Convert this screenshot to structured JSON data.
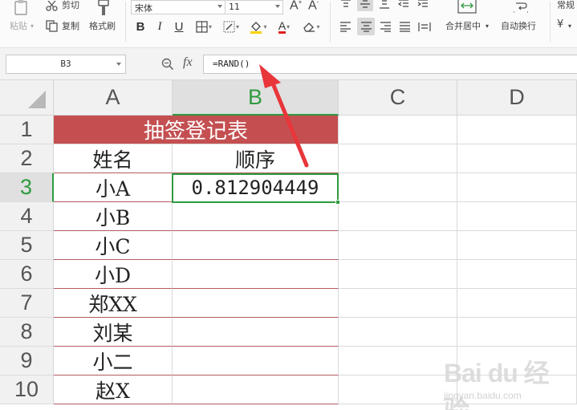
{
  "ribbon": {
    "paste_label": "粘贴",
    "cut_label": "剪切",
    "copy_label": "复制",
    "format_painter_label": "格式刷",
    "font_name": "宋体",
    "font_size": "11",
    "merge_center_label": "合并居中",
    "wrap_text_label": "自动换行",
    "number_format_label": "常规",
    "currency_symbol": "¥"
  },
  "formula_bar": {
    "name_box": "B3",
    "fx_label": "fx",
    "formula": "=RAND()"
  },
  "columns": [
    "A",
    "B",
    "C",
    "D"
  ],
  "active_column": "B",
  "rows": [
    "1",
    "2",
    "3",
    "4",
    "5",
    "6",
    "7",
    "8",
    "9",
    "10"
  ],
  "active_row": "3",
  "sheet": {
    "title": "抽签登记表",
    "header_name": "姓名",
    "header_order": "顺序",
    "names": [
      "小A",
      "小B",
      "小C",
      "小D",
      "郑XX",
      "刘某",
      "小二",
      "赵X"
    ],
    "order_values": [
      "0.812904449",
      "",
      "",
      "",
      "",
      "",
      "",
      ""
    ]
  },
  "colors": {
    "title_fill": "#c44f51",
    "accent_green": "#2f9a41",
    "annotation_arrow": "#e8363b"
  },
  "watermark": {
    "main": "Bai du 经验",
    "sub": "jingyan.baidu.com"
  }
}
